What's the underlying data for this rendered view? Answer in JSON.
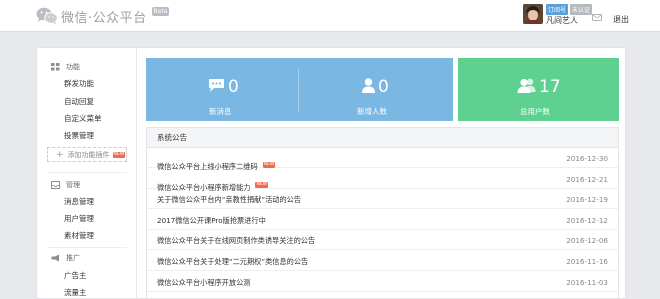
{
  "header": {
    "logo_text": "微信·公众平台",
    "beta_label": "Beta",
    "user_tags": [
      "订阅号",
      "未认证"
    ],
    "username": "凡间艺人",
    "logout_label": "退出"
  },
  "sidebar": {
    "sections": [
      {
        "title": "功能",
        "icon": "grid-icon",
        "items": [
          "群发功能",
          "自动回复",
          "自定义菜单",
          "投票管理"
        ]
      },
      {
        "title": "管理",
        "icon": "inbox-icon",
        "items": [
          "消息管理",
          "用户管理",
          "素材管理"
        ]
      },
      {
        "title": "推广",
        "icon": "promote-icon",
        "items": [
          "广告主",
          "流量主"
        ]
      }
    ],
    "add_plugin_label": "添加功能插件",
    "new_badge": "NEW"
  },
  "stats": [
    {
      "value": "0",
      "label": "新消息",
      "icon": "chat-icon"
    },
    {
      "value": "0",
      "label": "新增人数",
      "icon": "user-icon"
    },
    {
      "value": "17",
      "label": "总用户数",
      "icon": "users-icon"
    }
  ],
  "colors": {
    "stat_blue": "#7ab7e3",
    "stat_green": "#5ed08f",
    "new_badge": "#f06c4f"
  },
  "announcements": {
    "title": "系统公告",
    "new_badge": "NEW",
    "items": [
      {
        "title": "微信公众平台上线小程序二维码",
        "date": "2016-12-30",
        "is_new": true
      },
      {
        "title": "微信公众平台小程序新增能力",
        "date": "2016-12-21",
        "is_new": true
      },
      {
        "title": "关于微信公众平台内“亲教性捐献”活动的公告",
        "date": "2016-12-19",
        "is_new": false
      },
      {
        "title": "2017微信公开课Pro版抢票进行中",
        "date": "2016-12-12",
        "is_new": false
      },
      {
        "title": "微信公众平台关于在线网页制作类诱导关注的公告",
        "date": "2016-12-06",
        "is_new": false
      },
      {
        "title": "微信公众平台关于处理“二元期权”类信息的公告",
        "date": "2016-11-16",
        "is_new": false
      },
      {
        "title": "微信公众平台小程序开放公测",
        "date": "2016-11-03",
        "is_new": false
      }
    ]
  }
}
